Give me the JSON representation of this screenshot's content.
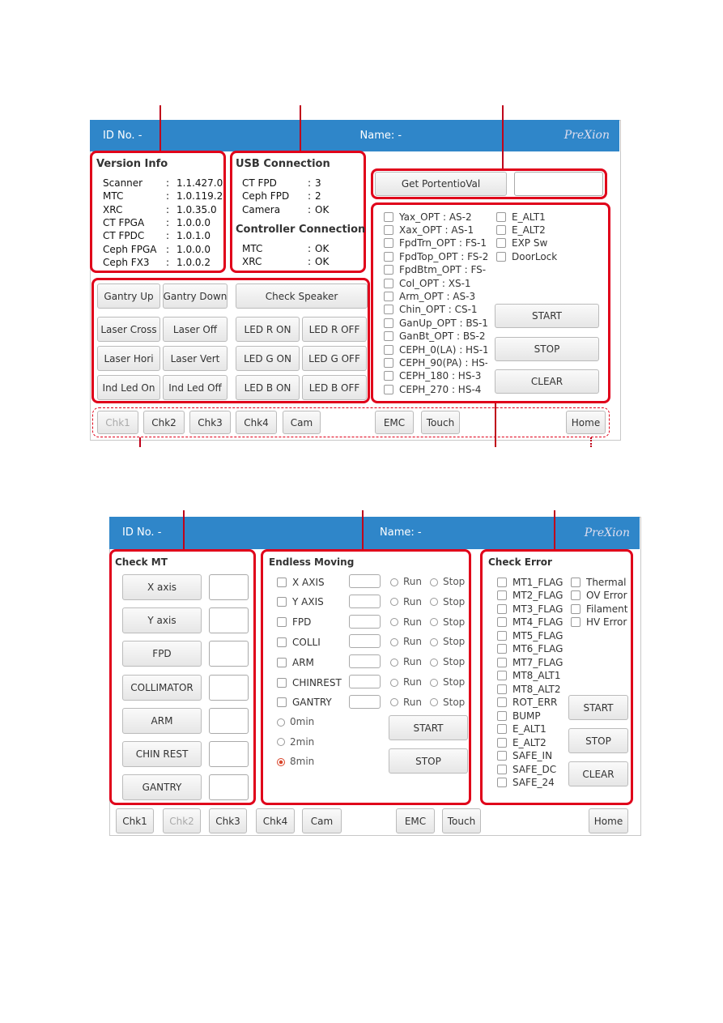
{
  "screen1": {
    "header": {
      "id_label": "ID No. -",
      "name_label": "Name: -",
      "logo": "PreXion"
    },
    "version_info": {
      "title": "Version Info",
      "rows": [
        {
          "label": "Scanner",
          "value": "1.1.427.0"
        },
        {
          "label": "MTC",
          "value": "1.0.119.2"
        },
        {
          "label": "XRC",
          "value": "1.0.35.0"
        },
        {
          "label": "CT FPGA",
          "value": "1.0.0.0"
        },
        {
          "label": "CT FPDC",
          "value": "1.0.1.0"
        },
        {
          "label": "Ceph FPGA",
          "value": "1.0.0.0"
        },
        {
          "label": "Ceph FX3",
          "value": "1.0.0.2"
        }
      ]
    },
    "usb": {
      "title": "USB Connection",
      "rows": [
        {
          "label": "CT FPD",
          "value": "3"
        },
        {
          "label": "Ceph FPD",
          "value": "2"
        },
        {
          "label": "Camera",
          "value": "OK"
        }
      ]
    },
    "controller": {
      "title": "Controller Connection",
      "rows": [
        {
          "label": "MTC",
          "value": "OK"
        },
        {
          "label": "XRC",
          "value": "OK"
        }
      ]
    },
    "portentio": {
      "button": "Get PortentioVal",
      "value": ""
    },
    "checks_left": [
      "Yax_OPT : AS-2",
      "Xax_OPT : AS-1",
      "FpdTrn_OPT : FS-1",
      "FpdTop_OPT : FS-2",
      "FpdBtm_OPT : FS-",
      "Col_OPT : XS-1",
      "Arm_OPT : AS-3",
      "Chin_OPT : CS-1",
      "GanUp_OPT : BS-1",
      "GanBt_OPT : BS-2",
      "CEPH_0(LA) : HS-1",
      "CEPH_90(PA) : HS-",
      "CEPH_180 : HS-3",
      "CEPH_270 : HS-4"
    ],
    "checks_right": [
      "E_ALT1",
      "E_ALT2",
      "EXP Sw",
      "DoorLock"
    ],
    "actions": [
      "START",
      "STOP",
      "CLEAR"
    ],
    "buttons": [
      "Gantry Up",
      "Gantry Down",
      "Check Speaker",
      "Laser Cross",
      "Laser Off",
      "LED R ON",
      "LED R OFF",
      "Laser Hori",
      "Laser Vert",
      "LED G ON",
      "LED G OFF",
      "Ind Led On",
      "Ind Led Off",
      "LED B ON",
      "LED B OFF"
    ],
    "nav": [
      "Chk1",
      "Chk2",
      "Chk3",
      "Chk4",
      "Cam",
      "EMC",
      "Touch",
      "Home"
    ]
  },
  "screen2": {
    "header": {
      "id_label": "ID No. -",
      "name_label": "Name: -",
      "logo": "PreXion"
    },
    "check_mt": {
      "title": "Check MT",
      "buttons": [
        "X axis",
        "Y axis",
        "FPD",
        "COLLIMATOR",
        "ARM",
        "CHIN REST",
        "GANTRY"
      ]
    },
    "endless": {
      "title": "Endless Moving",
      "axes": [
        "X AXIS",
        "Y AXIS",
        "FPD",
        "COLLI",
        "ARM",
        "CHINREST",
        "GANTRY"
      ],
      "run": "Run",
      "stop": "Stop",
      "durations": [
        "0min",
        "2min",
        "8min"
      ],
      "selected_duration": "8min",
      "start": "START",
      "stop_button": "STOP"
    },
    "check_error": {
      "title": "Check Error",
      "left": [
        "MT1_FLAG",
        "MT2_FLAG",
        "MT3_FLAG",
        "MT4_FLAG",
        "MT5_FLAG",
        "MT6_FLAG",
        "MT7_FLAG",
        "MT8_ALT1",
        "MT8_ALT2",
        "ROT_ERR",
        "BUMP",
        "E_ALT1",
        "E_ALT2",
        "SAFE_IN",
        "SAFE_DC",
        "SAFE_24"
      ],
      "right": [
        "Thermal",
        "OV Error",
        "Filament",
        "HV Error"
      ],
      "actions": [
        "START",
        "STOP",
        "CLEAR"
      ]
    },
    "nav": [
      "Chk1",
      "Chk2",
      "Chk3",
      "Chk4",
      "Cam",
      "EMC",
      "Touch",
      "Home"
    ]
  },
  "colors": {
    "header": "#2f86c9",
    "callout": "#e0001a"
  }
}
